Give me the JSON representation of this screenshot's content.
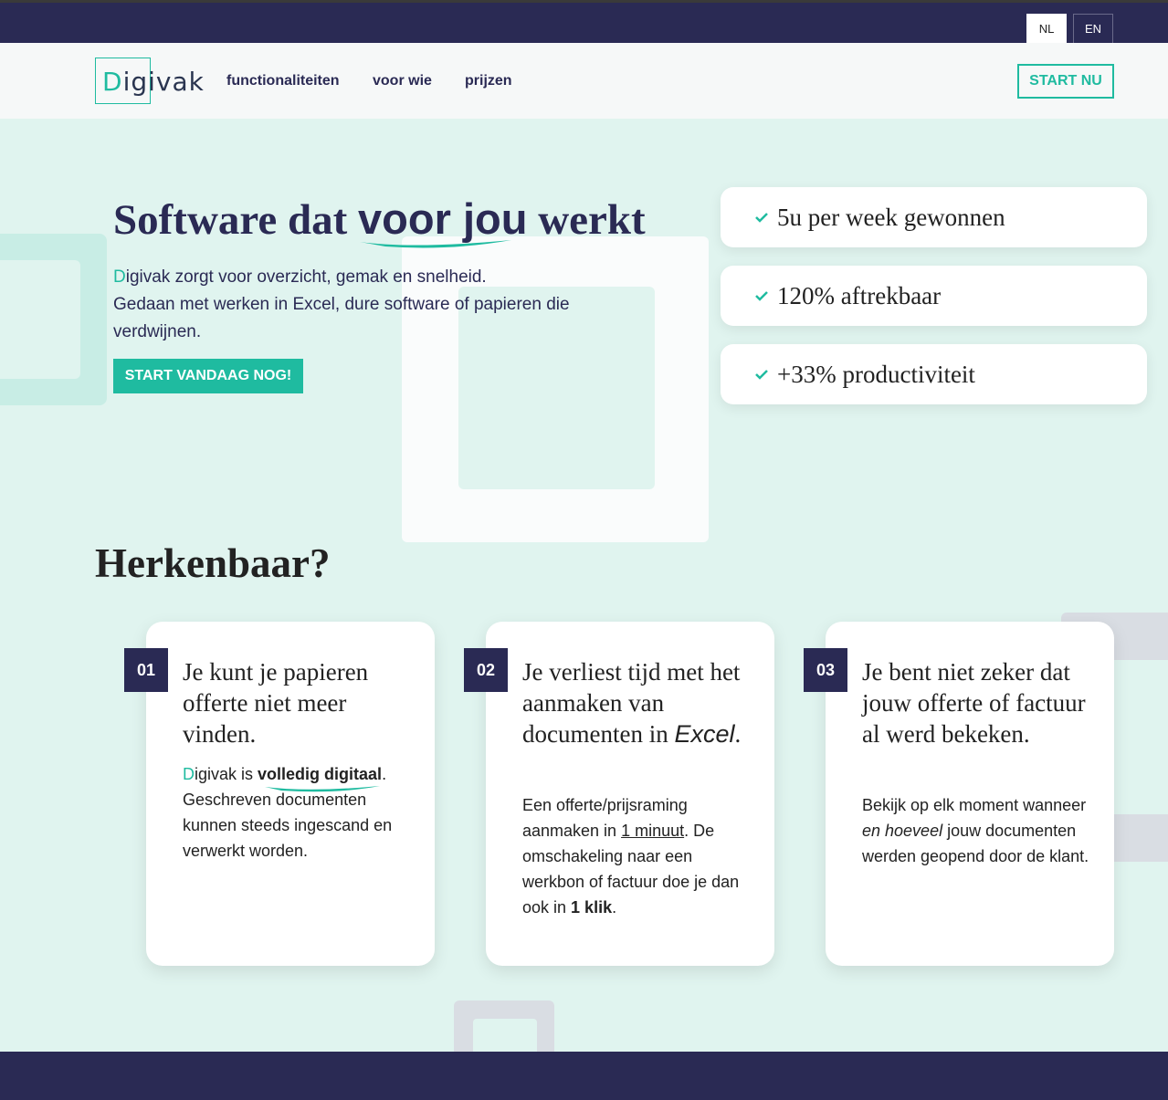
{
  "colors": {
    "navy": "#2a2a54",
    "teal": "#1fbba0",
    "bg": "#e0f4ef"
  },
  "lang": {
    "nl": "NL",
    "en": "EN"
  },
  "logo": {
    "first_letter": "D",
    "rest": "igivak"
  },
  "nav": {
    "items": [
      "functionaliteiten",
      "voor wie",
      "prijzen"
    ],
    "cta": "START NU"
  },
  "hero": {
    "title_before": "Software dat ",
    "title_highlight": "voor jou",
    "title_after": " werkt",
    "text_first_letter": "D",
    "text_line1_rest": "igivak zorgt voor overzicht, gemak en snelheid.",
    "text_line2": "Gedaan met werken in Excel, dure software of papieren die verdwijnen.",
    "cta": "START VANDAAG NOG!"
  },
  "benefits": [
    {
      "icon": "check-icon",
      "text": "5u per week gewonnen"
    },
    {
      "icon": "check-icon",
      "text": "120% aftrekbaar"
    },
    {
      "icon": "check-icon",
      "text": "+33% productiviteit"
    }
  ],
  "section": {
    "title": "Herkenbaar?"
  },
  "cards": [
    {
      "num": "01",
      "title": "Je kunt je papieren offerte niet meer vinden.",
      "body": {
        "first_letter": "D",
        "a": "igivak is ",
        "emph": "volledig digitaal",
        "b": ". Geschreven documenten kunnen steeds ingescand en verwerkt worden."
      }
    },
    {
      "num": "02",
      "title_a": "Je verliest tijd met het aanmaken van documenten in ",
      "title_italic": "Excel",
      "title_b": ".",
      "body": {
        "a": "Een offerte/prijsraming aanmaken in ",
        "underline": "1 minuut",
        "b": ". De omschakeling naar een werkbon of factuur doe je dan ook in ",
        "strong": "1 klik",
        "c": "."
      }
    },
    {
      "num": "03",
      "title": "Je bent niet zeker dat jouw offerte of factuur al werd bekeken.",
      "body": {
        "a": "Bekijk op elk moment wanneer ",
        "italic": "en hoeveel",
        "b": " jouw documenten werden geopend door de klant."
      }
    }
  ]
}
